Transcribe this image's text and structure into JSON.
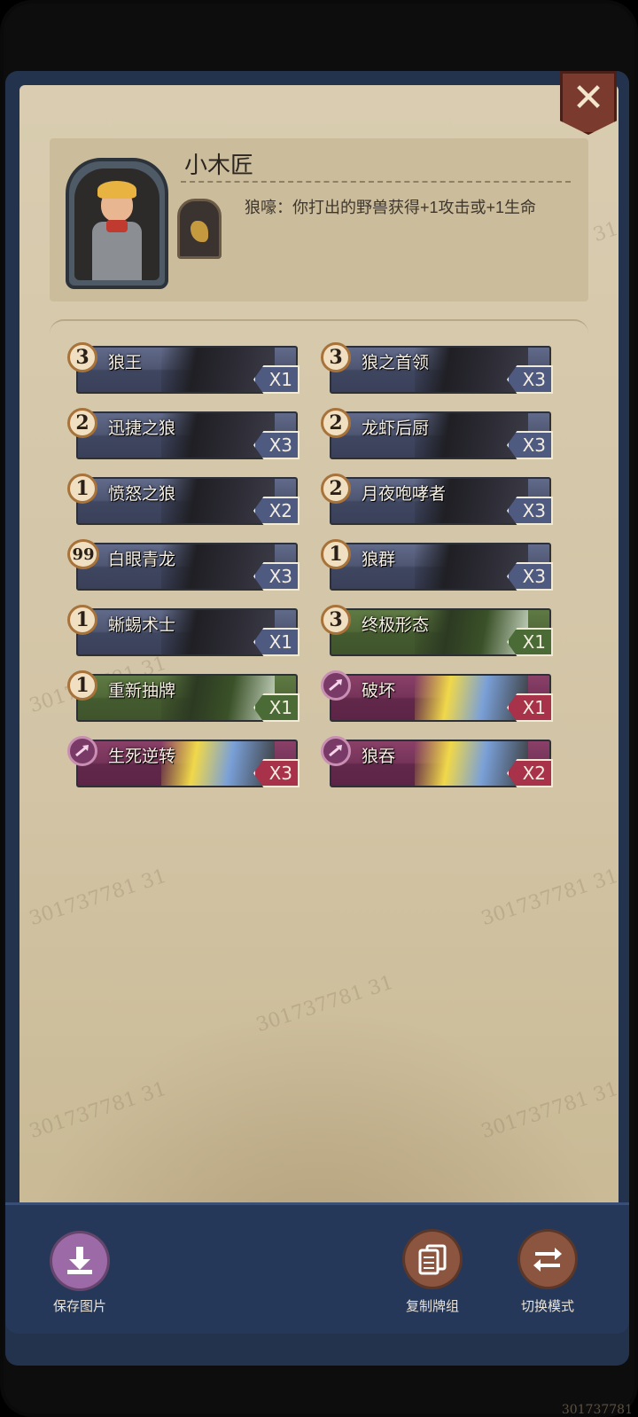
{
  "dialog": {
    "close_glyph": "✕"
  },
  "hero": {
    "name": "小木匠",
    "skill": "狼嚎：你打出的野兽获得+1攻击或+1生命"
  },
  "cards": [
    {
      "cost": "3",
      "name": "狼王",
      "count": "X1",
      "style": "blue",
      "tag": "blue"
    },
    {
      "cost": "3",
      "name": "狼之首领",
      "count": "X3",
      "style": "blue",
      "tag": "blue"
    },
    {
      "cost": "2",
      "name": "迅捷之狼",
      "count": "X3",
      "style": "blue",
      "tag": "blue"
    },
    {
      "cost": "2",
      "name": "龙虾后厨",
      "count": "X3",
      "style": "blue",
      "tag": "blue"
    },
    {
      "cost": "1",
      "name": "愤怒之狼",
      "count": "X2",
      "style": "blue",
      "tag": "blue"
    },
    {
      "cost": "2",
      "name": "月夜咆哮者",
      "count": "X3",
      "style": "blue",
      "tag": "blue"
    },
    {
      "cost": "99",
      "name": "白眼青龙",
      "count": "X3",
      "style": "blue",
      "tag": "blue"
    },
    {
      "cost": "1",
      "name": "狼群",
      "count": "X3",
      "style": "blue",
      "tag": "blue"
    },
    {
      "cost": "1",
      "name": "蜥蜴术士",
      "count": "X1",
      "style": "blue",
      "tag": "blue"
    },
    {
      "cost": "3",
      "name": "终极形态",
      "count": "X1",
      "style": "green",
      "tag": "green"
    },
    {
      "cost": "1",
      "name": "重新抽牌",
      "count": "X1",
      "style": "green",
      "tag": "green"
    },
    {
      "cost": "",
      "name": "破坏",
      "count": "X1",
      "style": "purple",
      "tag": "red"
    },
    {
      "cost": "",
      "name": "生死逆转",
      "count": "X3",
      "style": "purple",
      "tag": "red"
    },
    {
      "cost": "",
      "name": "狼吞",
      "count": "X2",
      "style": "purple",
      "tag": "red"
    }
  ],
  "toolbar": {
    "save_label": "保存图片",
    "copy_label": "复制牌组",
    "switch_label": "切换模式"
  },
  "watermark": "301737781 31",
  "corner_id": "301737781"
}
